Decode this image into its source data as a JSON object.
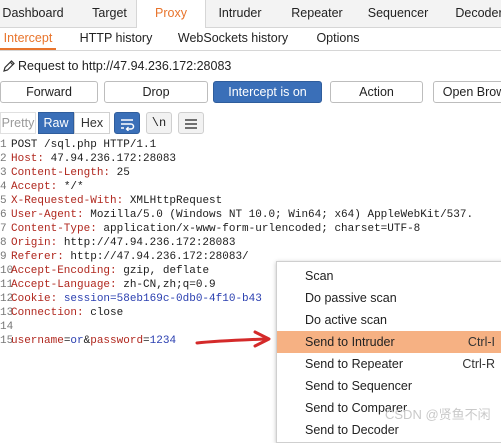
{
  "top_tabs": [
    "Dashboard",
    "Target",
    "Proxy",
    "Intruder",
    "Repeater",
    "Sequencer",
    "Decoder"
  ],
  "sub_tabs": [
    "Intercept",
    "HTTP history",
    "WebSockets history",
    "Options"
  ],
  "request_line": "Request to http://47.94.236.172:28083",
  "buttons": {
    "forward": "Forward",
    "drop": "Drop",
    "intercept": "Intercept is on",
    "action": "Action",
    "open_browser": "Open Brow"
  },
  "view_modes": {
    "pretty": "Pretty",
    "raw": "Raw",
    "hex": "Hex",
    "newline": "\\n"
  },
  "request": {
    "start": "POST /sql.php HTTP/1.1",
    "headers": [
      {
        "name": "Host",
        "value": "47.94.236.172:28083"
      },
      {
        "name": "Content-Length",
        "value": "25"
      },
      {
        "name": "Accept",
        "value": "*/*"
      },
      {
        "name": "X-Requested-With",
        "value": "XMLHttpRequest"
      },
      {
        "name": "User-Agent",
        "value": "Mozilla/5.0 (Windows NT 10.0; Win64; x64) AppleWebKit/537."
      },
      {
        "name": "Content-Type",
        "value": "application/x-www-form-urlencoded; charset=UTF-8"
      },
      {
        "name": "Origin",
        "value": "http://47.94.236.172:28083"
      },
      {
        "name": "Referer",
        "value": "http://47.94.236.172:28083/"
      },
      {
        "name": "Accept-Encoding",
        "value": "gzip, deflate"
      },
      {
        "name": "Accept-Language",
        "value": "zh-CN,zh;q=0.9"
      },
      {
        "name": "Cookie",
        "value": "session=58eb169c-0db0-4f10-b43"
      },
      {
        "name": "Connection",
        "value": "close"
      }
    ],
    "body": {
      "p1": "username",
      "v1": "or",
      "p2": "password",
      "v2": "1234"
    },
    "line_numbers": [
      "1",
      "2",
      "3",
      "4",
      "5",
      "6",
      "7",
      "8",
      "9",
      "10",
      "11",
      "12",
      "13",
      "14",
      "15"
    ]
  },
  "context_menu": [
    {
      "label": "Scan",
      "shortcut": ""
    },
    {
      "label": "Do passive scan",
      "shortcut": ""
    },
    {
      "label": "Do active scan",
      "shortcut": ""
    },
    {
      "label": "Send to Intruder",
      "shortcut": "Ctrl-I",
      "highlighted": true
    },
    {
      "label": "Send to Repeater",
      "shortcut": "Ctrl-R"
    },
    {
      "label": "Send to Sequencer",
      "shortcut": ""
    },
    {
      "label": "Send to Comparer",
      "shortcut": ""
    },
    {
      "label": "Send to Decoder",
      "shortcut": ""
    }
  ],
  "watermark": "CSDN @贤鱼不闲",
  "colors": {
    "accent": "#e8742c",
    "primary_button": "#3a6fb8",
    "menu_highlight": "#f6b183",
    "arrow": "#d42a2a"
  }
}
